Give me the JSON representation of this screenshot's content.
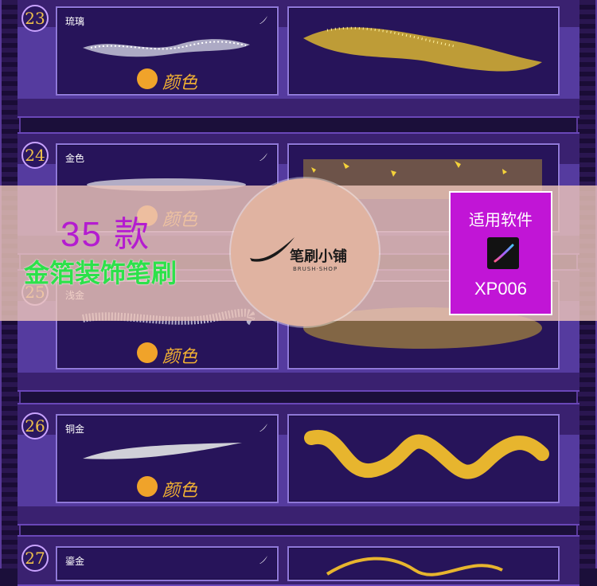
{
  "rows": [
    {
      "number": "23",
      "name": "琉璃",
      "color_label": "颜色"
    },
    {
      "number": "24",
      "name": "金色",
      "color_label": "颜色"
    },
    {
      "number": "25",
      "name": "浅金",
      "color_label": "颜色"
    },
    {
      "number": "26",
      "name": "铜金",
      "color_label": "颜色"
    },
    {
      "number": "27",
      "name": "鎏金",
      "color_label": "颜色"
    }
  ],
  "promo": {
    "count": "35 款",
    "title": "金箔装饰笔刷"
  },
  "logo": {
    "text": "笔刷小铺",
    "subtext": "BRUSH·SHOP"
  },
  "compat": {
    "title": "适用软件",
    "code": "XP006",
    "app_icon": "procreate-icon"
  },
  "colors": {
    "gold": "#f0b62a",
    "badge_number": "#f0c24a",
    "promo_count": "#b41cd0",
    "promo_title": "#2ce14a",
    "compat_bg": "#c115d6"
  }
}
